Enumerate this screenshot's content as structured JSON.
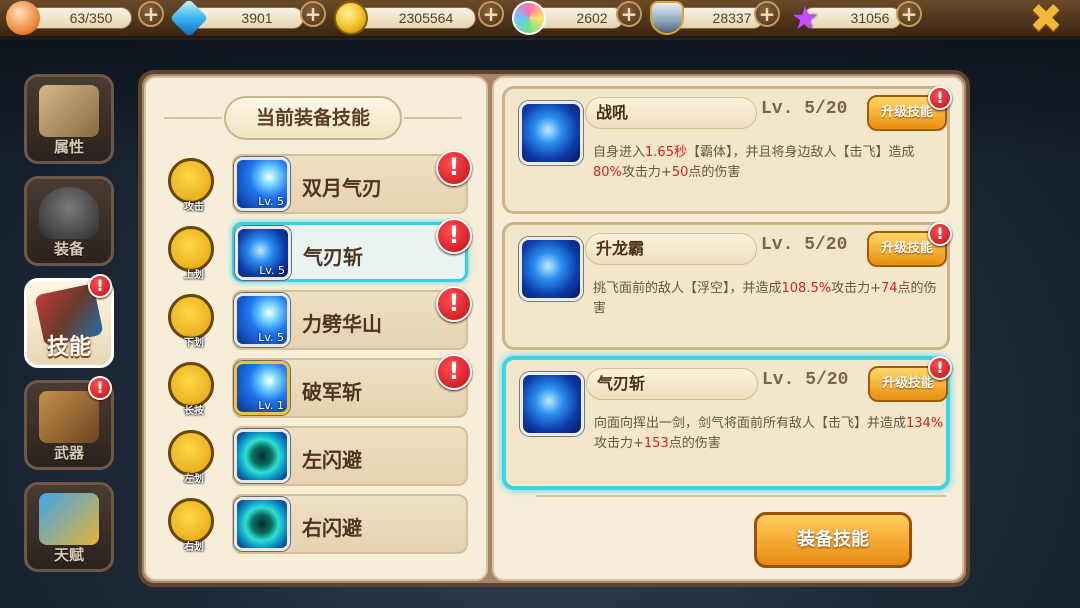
{
  "resources": {
    "stamina": "63/350",
    "gems": "3901",
    "gold": "2305564",
    "candy": "2602",
    "honor": "28337",
    "stars": "31056"
  },
  "nav": [
    {
      "label": "属性"
    },
    {
      "label": "装备"
    },
    {
      "label": "技能"
    },
    {
      "label": "武器"
    },
    {
      "label": "天赋"
    }
  ],
  "left_panel": {
    "title": "当前装备技能",
    "rows": [
      {
        "control": "攻击",
        "name": "双月气刃",
        "level": "Lv. 5"
      },
      {
        "control": "上划",
        "name": "气刃斩",
        "level": "Lv. 5"
      },
      {
        "control": "下划",
        "name": "力劈华山",
        "level": "Lv. 5"
      },
      {
        "control": "长按",
        "name": "破军斩",
        "level": "Lv. 1"
      },
      {
        "control": "左划",
        "name": "左闪避",
        "level": ""
      },
      {
        "control": "右划",
        "name": "右闪避",
        "level": ""
      }
    ]
  },
  "skills": [
    {
      "name": "战吼",
      "level": "Lv. 5/20",
      "upgrade": "升级技能",
      "desc": [
        "自身进入",
        "1.65秒",
        "【霸体】，并且将身边敌人【击飞】造成",
        "80%",
        "攻击力+",
        "50",
        "点的伤害"
      ]
    },
    {
      "name": "升龙霸",
      "level": "Lv. 5/20",
      "upgrade": "升级技能",
      "desc": [
        "挑飞面前的敌人【浮空】，并造成",
        "108.5%",
        "攻击力+",
        "74",
        "点的伤害"
      ]
    },
    {
      "name": "气刃斩",
      "level": "Lv. 5/20",
      "upgrade": "升级技能",
      "desc": [
        "向面向挥出一剑，剑气将面前所有敌人【击飞】并造成",
        "134%",
        "攻击力+",
        "153",
        "点的伤害"
      ]
    }
  ],
  "equip_button": "装备技能",
  "alert_mark": "!",
  "plus_mark": "+",
  "close_mark": "✖"
}
